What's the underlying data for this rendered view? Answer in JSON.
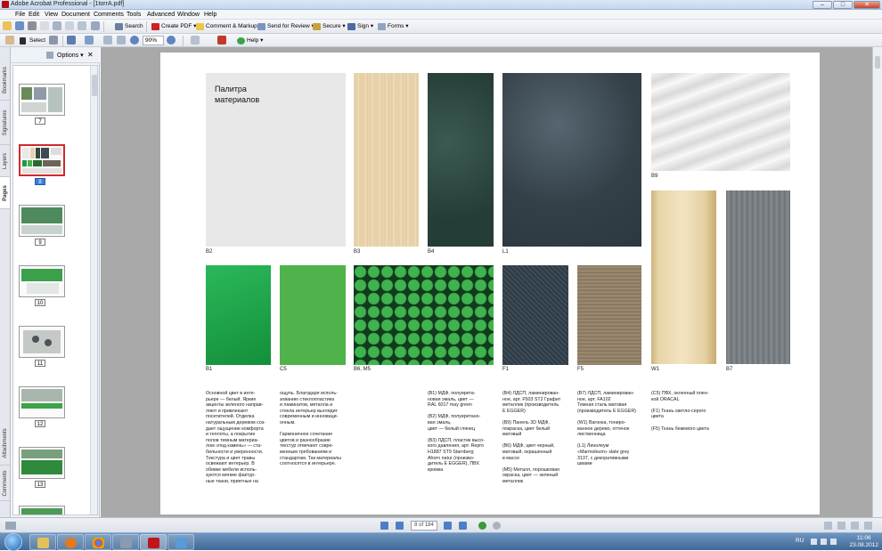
{
  "window": {
    "title": "Adobe Acrobat Professional - [1torrA.pdf]",
    "min": "–",
    "max": "□",
    "close": "✕"
  },
  "menu": [
    "File",
    "Edit",
    "View",
    "Document",
    "Comments",
    "Tools",
    "Advanced",
    "Window",
    "Help"
  ],
  "toolbar1": {
    "search": "Search",
    "create_pdf": "Create PDF",
    "comment_markup": "Comment & Markup",
    "send_review": "Send for Review",
    "secure": "Secure",
    "sign": "Sign",
    "forms": "Forms"
  },
  "toolbar2": {
    "select": "Select",
    "zoom": "90%",
    "help": "Help"
  },
  "side_tabs": [
    "Bookmarks",
    "Signatures",
    "Layers",
    "Pages",
    "Attachments",
    "Comments"
  ],
  "panel": {
    "options": "Options",
    "close": "✕"
  },
  "thumbnails": [
    {
      "n": "7",
      "sel": false
    },
    {
      "n": "8",
      "sel": true
    },
    {
      "n": "9",
      "sel": false
    },
    {
      "n": "10",
      "sel": false
    },
    {
      "n": "11",
      "sel": false
    },
    {
      "n": "12",
      "sel": false
    },
    {
      "n": "13",
      "sel": false
    }
  ],
  "document": {
    "heading": "Палитра\nматериалов",
    "codes": {
      "b2": "B2",
      "b3": "B3",
      "b4": "B4",
      "l1": "L1",
      "b9": "B9",
      "b1": "B1",
      "c5": "C5",
      "b6m5": "B6, M5",
      "f1": "F1",
      "f5": "F5",
      "w1": "W1",
      "b7": "B7"
    },
    "col1": "Основной цвет в инте-\nрьере — белый. Яркие\nакценты зеленого направ-\nляют и привлекают\nпосетителей. Отделка\nнатуральным деревом соз-\nдает ощущение комфорта\nи теплоты, а покрытие\nполов темным материа-\nлом «под камень» — ста-\nбильности и уверенности.\nТекстура и цвет травы\nосвежают интерьер. В\nобивке мебели исполь-\nзуются мягкие фактур-\nные ткани, приятные на",
    "col2": "ощупь. Благодаря исполь-\nзованию стеклопластика\nи ламинатов, металла и\nстекла интерьер выглядит\nсовременным и инноваци-\nонным.\n\nГармоничное сочетание\nцветов и разнообразие\nтекстур отвечают совре-\nменным требованиям и\nстандартам. Так материалы\nсоотносятся в интерьере.",
    "col3": "(B1) МДФ, полуирета-\nновая эмаль, цвет —\nRAL 6017 may green\n\n(B2) МДФ, полуиретано-\nвая эмаль,\nцвет — белый глянец\n\n(B3) ЛДСП, пластик высо-\nкого давления, арт. Repro\nH1887 ST9 Starnberg\nAhorn natur (произво-\nдитель E EGGER), ПВХ\nкромка",
    "col4": "(B4) ЛДСП, ламинирован-\nное, арт. F503 ST2 Графит\nметаллик (производитель\nE EGGER)\n\n(B9) Панель 3D МДФ,\nпокраска, цвет белый\nматовый\n\n(B6) МДФ, цвет черный,\nматовый, окрашенный\nв массе\n\n(M5) Металл, порошковая\nокраска, цвет — зеленый\nметаллик",
    "col5": "(B7) ЛДСП, ламинирован-\nное, арт. FA102\nТемная сталь матовая\n(производитель E EGGER)\n\n(W1) Вагонка, тониро-\nванное дерево, оттенок\nлиственница\n\n(L1) Линолеум\n«Marmoleum» slate grey\n3137, с декоративными\nшвами",
    "col6": "(C5) ПВХ, оклееный плен-\nкой ORACAL\n\n(F1) Ткань светло-серого\nцвета\n\n(F5) Ткань бежевого цвета"
  },
  "status": {
    "page": "8 of 184"
  },
  "taskbar": {
    "lang": "RU",
    "time": "11:06",
    "date": "23.08.2012"
  }
}
